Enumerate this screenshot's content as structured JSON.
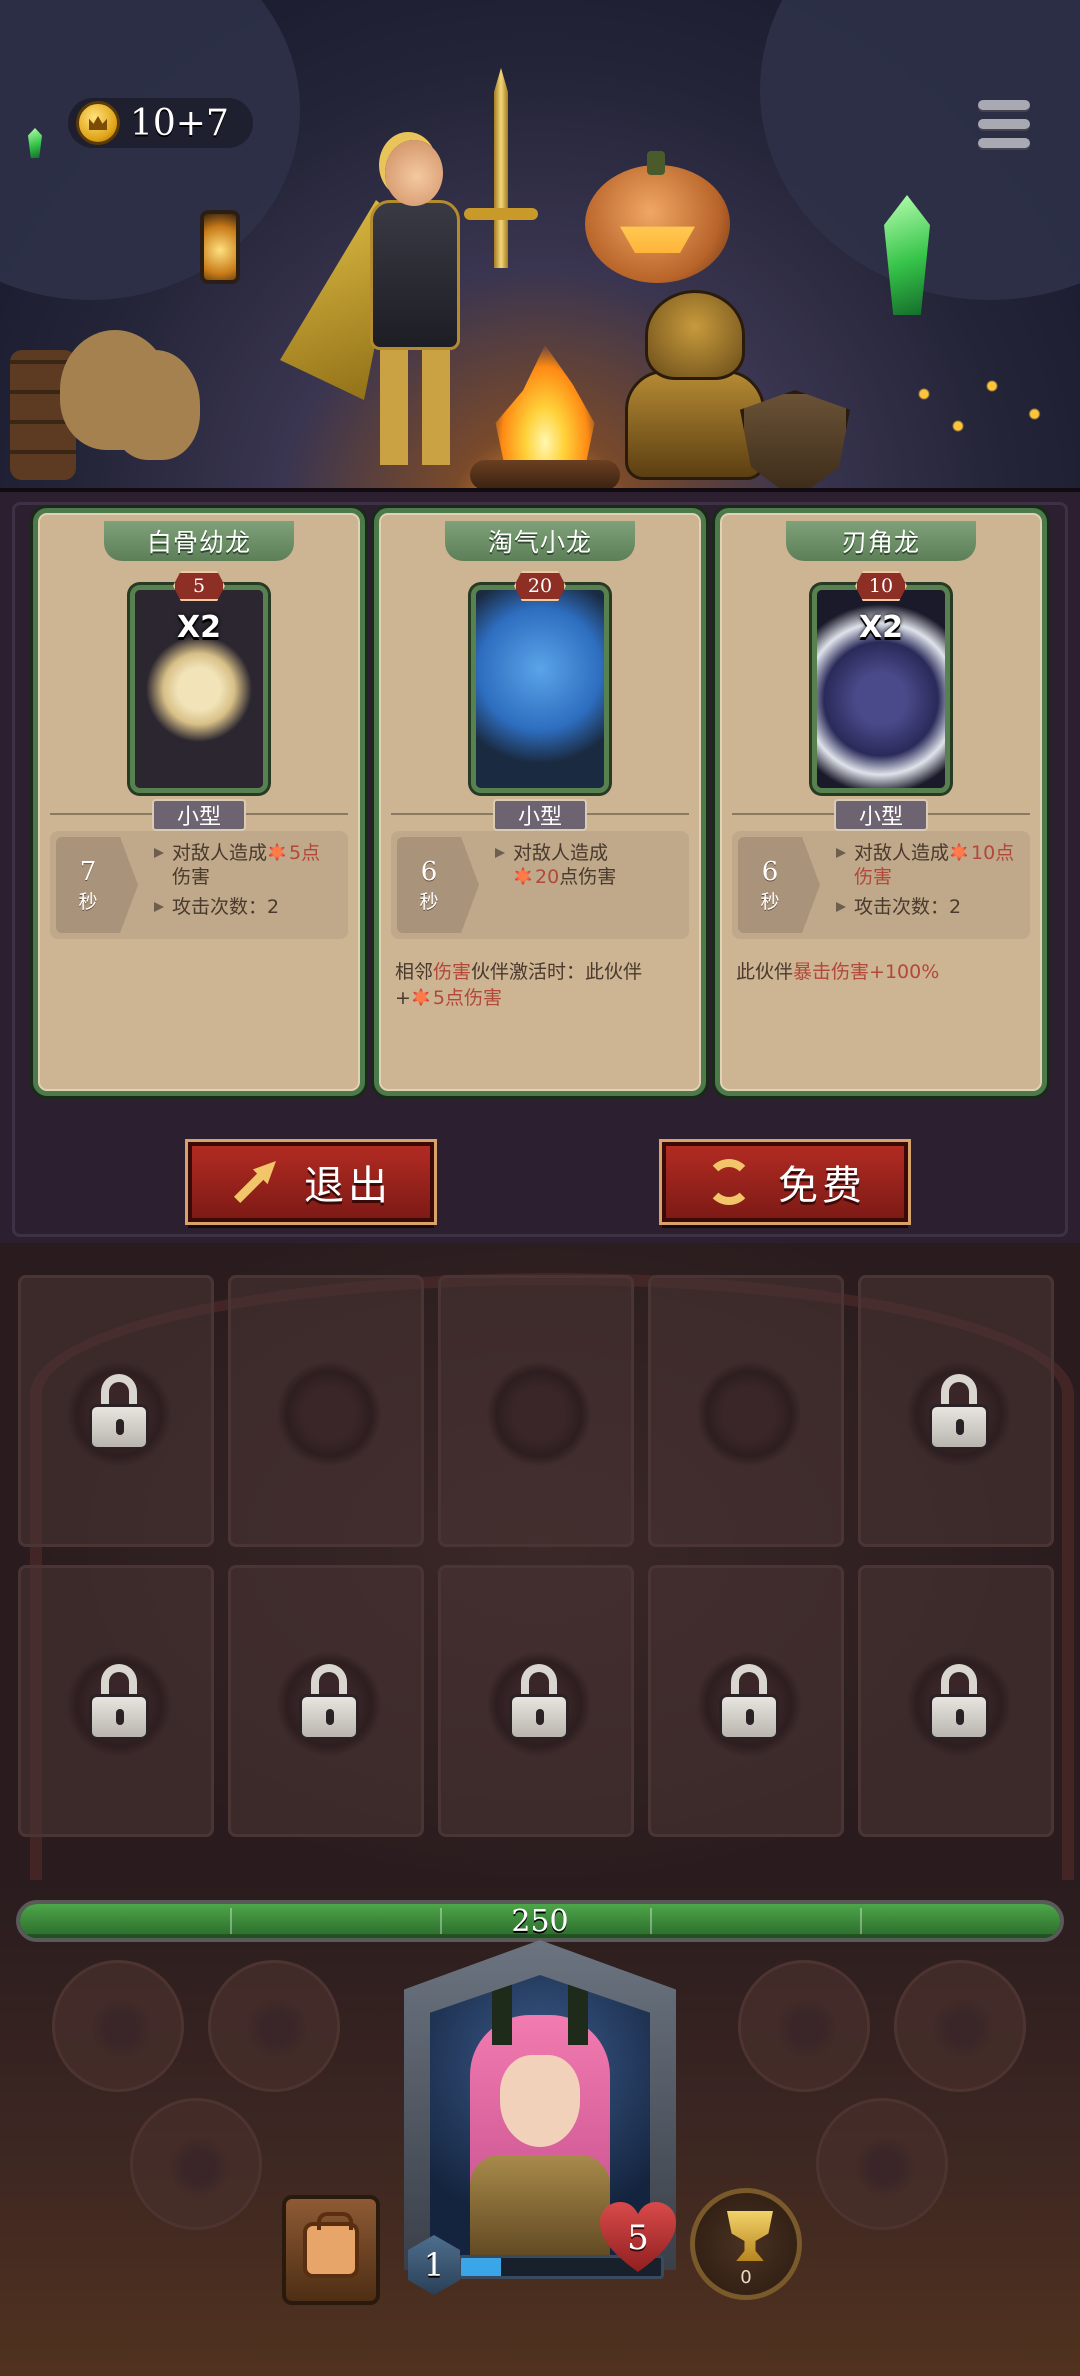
{
  "header": {
    "currency": "10+7"
  },
  "cards": [
    {
      "name": "白骨幼龙",
      "cost": "5",
      "multiplier": "X2",
      "size": "小型",
      "cooldown": "7",
      "cooldown_unit": "秒",
      "effect_prefix": "对敌人造成",
      "effect_value": "5点",
      "effect_suffix": "伤害",
      "hits": "攻击次数：2",
      "ability_a": "",
      "ability_hl": "",
      "ability_b": "",
      "ability_dmg": ""
    },
    {
      "name": "淘气小龙",
      "cost": "20",
      "multiplier": "",
      "size": "小型",
      "cooldown": "6",
      "cooldown_unit": "秒",
      "effect_prefix": "对敌人造成",
      "effect_value": "20",
      "effect_suffix": "点伤害",
      "hits": "",
      "ability_a": "相邻",
      "ability_hl": "伤害",
      "ability_b": "伙伴激活时：此伙伴",
      "ability_plus": "+",
      "ability_dmg": "5点伤害"
    },
    {
      "name": "刃角龙",
      "cost": "10",
      "multiplier": "X2",
      "size": "小型",
      "cooldown": "6",
      "cooldown_unit": "秒",
      "effect_prefix": "对敌人造成",
      "effect_value": "10点",
      "effect_suffix": "伤害",
      "hits": "攻击次数：2",
      "ability_a": "此伙伴",
      "ability_hl": "暴击伤害",
      "ability_b": "+100%",
      "ability_dmg": ""
    }
  ],
  "buttons": {
    "exit": "退出",
    "free": "免费"
  },
  "board": {
    "locked_slots": [
      true,
      false,
      false,
      false,
      true,
      true,
      true,
      true,
      true,
      true
    ]
  },
  "hud": {
    "hp": "250",
    "hp_fill": 1.0,
    "level": "1",
    "xp_fill": 0.2,
    "lives": "5",
    "trophies": "0"
  },
  "colors": {
    "card_border": "#4d7a4a",
    "button_red": "#b12b22",
    "hp_green": "#4ea64a",
    "highlight": "#b2483a"
  },
  "icons": [
    "crown-coin-icon",
    "menu-icon",
    "exit-arrow-icon",
    "refresh-icon",
    "lock-icon",
    "damage-burst-icon",
    "backpack-icon",
    "trophy-icon",
    "heart-icon"
  ]
}
